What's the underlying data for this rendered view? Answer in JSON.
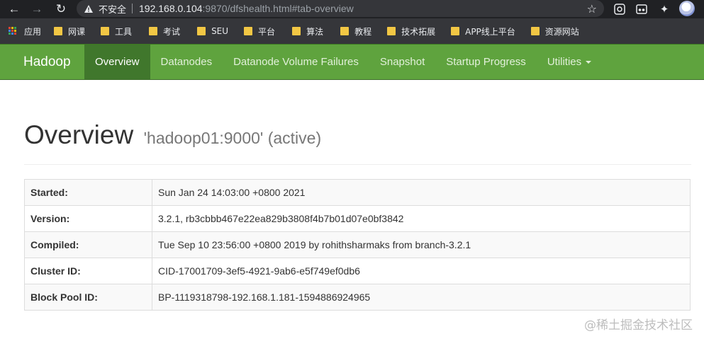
{
  "browser": {
    "insecure_label": "不安全",
    "url_host": "192.168.0.104",
    "url_rest": ":9870/dfshealth.html#tab-overview",
    "bookmarks": [
      {
        "label": "应用",
        "icon": "apps-grid-icon"
      },
      {
        "label": "网课",
        "icon": "folder-icon"
      },
      {
        "label": "工具",
        "icon": "folder-icon"
      },
      {
        "label": "考试",
        "icon": "folder-icon"
      },
      {
        "label": "SEU",
        "icon": "folder-icon"
      },
      {
        "label": "平台",
        "icon": "folder-icon"
      },
      {
        "label": "算法",
        "icon": "folder-icon"
      },
      {
        "label": "教程",
        "icon": "folder-icon"
      },
      {
        "label": "技术拓展",
        "icon": "folder-icon"
      },
      {
        "label": "APP线上平台",
        "icon": "folder-icon"
      },
      {
        "label": "资源网站",
        "icon": "folder-icon"
      }
    ]
  },
  "navbar": {
    "brand": "Hadoop",
    "items": [
      {
        "label": "Overview",
        "active": true
      },
      {
        "label": "Datanodes",
        "active": false
      },
      {
        "label": "Datanode Volume Failures",
        "active": false
      },
      {
        "label": "Snapshot",
        "active": false
      },
      {
        "label": "Startup Progress",
        "active": false
      },
      {
        "label": "Utilities",
        "active": false,
        "dropdown": true
      }
    ],
    "color": "#5fa33e",
    "active_color": "#40772c"
  },
  "page": {
    "title": "Overview",
    "subtitle": "'hadoop01:9000' (active)"
  },
  "info": [
    {
      "key": "Started:",
      "value": "Sun Jan 24 14:03:00 +0800 2021"
    },
    {
      "key": "Version:",
      "value": "3.2.1, rb3cbbb467e22ea829b3808f4b7b01d07e0bf3842"
    },
    {
      "key": "Compiled:",
      "value": "Tue Sep 10 23:56:00 +0800 2019 by rohithsharmaks from branch-3.2.1"
    },
    {
      "key": "Cluster ID:",
      "value": "CID-17001709-3ef5-4921-9ab6-e5f749ef0db6"
    },
    {
      "key": "Block Pool ID:",
      "value": "BP-1119318798-192.168.1.181-1594886924965"
    }
  ],
  "watermark": "@稀土掘金技术社区"
}
